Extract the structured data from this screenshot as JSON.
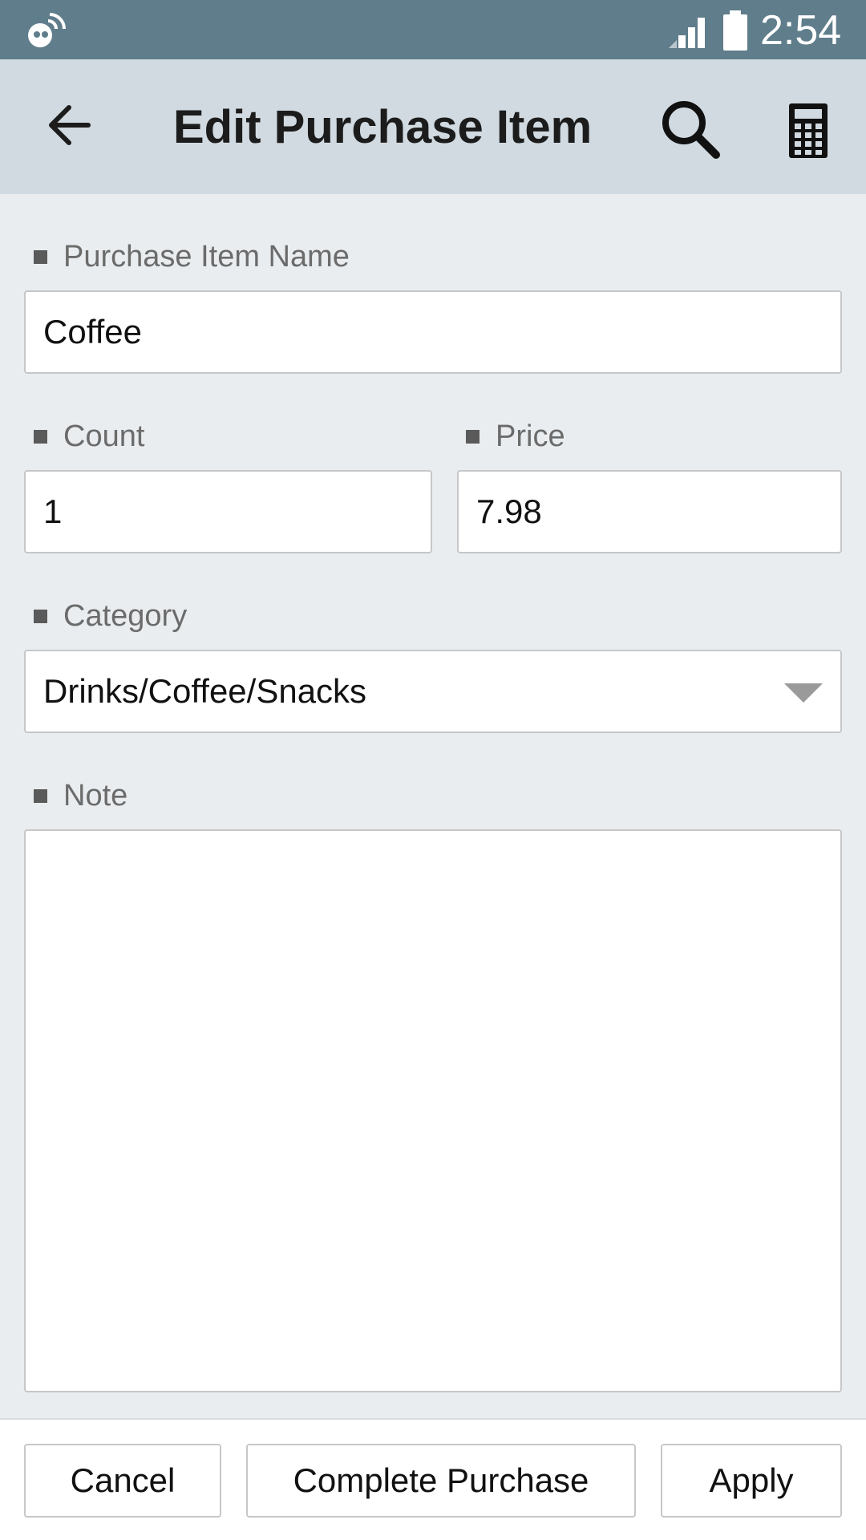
{
  "status_bar": {
    "time": "2:54",
    "icons": [
      "notification-app-icon",
      "signal-icon",
      "battery-icon"
    ]
  },
  "app_bar": {
    "title": "Edit Purchase Item",
    "icons": [
      "back-arrow-icon",
      "search-icon",
      "calculator-icon"
    ]
  },
  "form": {
    "name": {
      "label": "Purchase Item Name",
      "value": "Coffee"
    },
    "count": {
      "label": "Count",
      "value": "1"
    },
    "price": {
      "label": "Price",
      "value": "7.98"
    },
    "category": {
      "label": "Category",
      "value": "Drinks/Coffee/Snacks"
    },
    "note": {
      "label": "Note",
      "value": ""
    }
  },
  "actions": {
    "cancel": "Cancel",
    "complete": "Complete Purchase",
    "apply": "Apply"
  },
  "colors": {
    "status_bar": "#5f7d8b",
    "app_bar": "#d1dae0",
    "background": "#e9edf0"
  }
}
